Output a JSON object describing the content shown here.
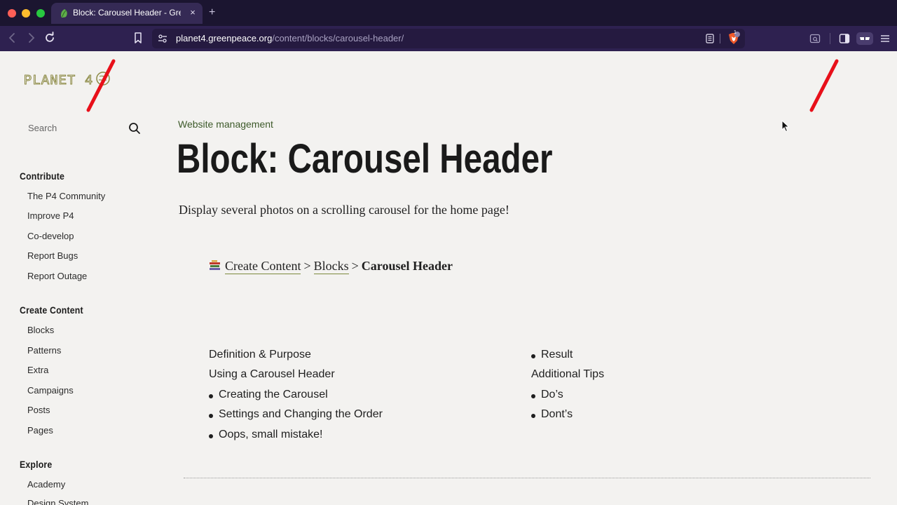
{
  "browser": {
    "tab_title": "Block: Carousel Header - Gree",
    "tab_close": "×",
    "new_tab": "+",
    "url_host": "planet4.greenpeace.org",
    "url_path": "/content/blocks/carousel-header/",
    "shield_badge": "1"
  },
  "sidebar": {
    "logo": "PLANET 4",
    "search_placeholder": "Search",
    "sections": [
      {
        "title": "Contribute",
        "items": [
          "The P4 Community",
          "Improve P4",
          "Co-develop",
          "Report Bugs",
          "Report Outage"
        ]
      },
      {
        "title": "Create Content",
        "items": [
          "Blocks",
          "Patterns",
          "Extra",
          "Campaigns",
          "Posts",
          "Pages"
        ]
      },
      {
        "title": "Explore",
        "items": [
          "Academy",
          "Design System"
        ]
      }
    ]
  },
  "main": {
    "kicker": "Website management",
    "title": "Block: Carousel Header",
    "lead": "Display several photos on a scrolling carousel for the home page!",
    "breadcrumb": {
      "first": "Create Content",
      "second": "Blocks",
      "current": "Carousel Header",
      "separator": ">"
    },
    "toc_left": [
      {
        "text": "Definition & Purpose",
        "bullet": false
      },
      {
        "text": "Using a Carousel Header",
        "bullet": false
      },
      {
        "text": "Creating the Carousel",
        "bullet": true
      },
      {
        "text": "Settings and Changing the Order",
        "bullet": true
      },
      {
        "text": "Oops, small mistake!",
        "bullet": true
      }
    ],
    "toc_right": [
      {
        "text": "Result",
        "bullet": true
      },
      {
        "text": "Additional Tips",
        "bullet": false
      },
      {
        "text": "Do’s",
        "bullet": true
      },
      {
        "text": "Dont’s",
        "bullet": true
      }
    ]
  },
  "colors": {
    "kicker": "#3d5a2a",
    "annotation_red": "#e8101a",
    "chrome_bg": "#2e2150"
  }
}
